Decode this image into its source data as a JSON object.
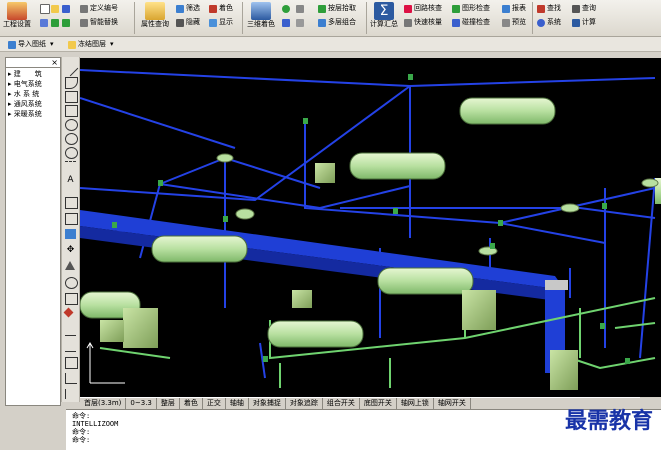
{
  "ribbon": {
    "project": "工程设置",
    "define_number": "定义编号",
    "smart_replace": "智能替换",
    "filter": "筛选",
    "hide": "隐藏",
    "view_color": "着色",
    "show": "显示",
    "property_query": "属性查询",
    "view_3d": "三维着色",
    "layer_tools": "按层拾取",
    "multi_combine": "多层组合",
    "calc_summary": "计算汇总",
    "circuit_check": "回路核查",
    "shape_check": "图形检查",
    "quick_check": "快速核量",
    "report": "报表",
    "cross_check": "碰撞检查",
    "preview": "预览",
    "find": "查找",
    "system": "系统",
    "batch": "查询",
    "calculator": "计算"
  },
  "toolbar2": {
    "import_drawing": "导入图纸",
    "freeze_layer": "冻结图层"
  },
  "tree": {
    "items": [
      "建　　筑",
      "电气系统",
      "水 系 统",
      "通风系统",
      "采暖系统"
    ]
  },
  "status": {
    "layer": "首层(3.3m)",
    "elevation": "0~3.3",
    "view_mode": "整层",
    "buttons": [
      "着色",
      "正交",
      "轴轴",
      "对象捕捉",
      "对象追踪",
      "组合开关",
      "底图开关",
      "轴网上锁",
      "轴网开关"
    ]
  },
  "command": {
    "lines": [
      "命令:",
      "INTELLIZOOM",
      "命令:",
      "命令:"
    ]
  },
  "watermark": "最需教育",
  "colors": {
    "viewport_bg": "#000000",
    "duct_blue": "#1f3fd6",
    "pipe_green": "#6fd36f",
    "fixture_green": "#b8e0a0",
    "ribbon_bg": "#ece9e2"
  }
}
